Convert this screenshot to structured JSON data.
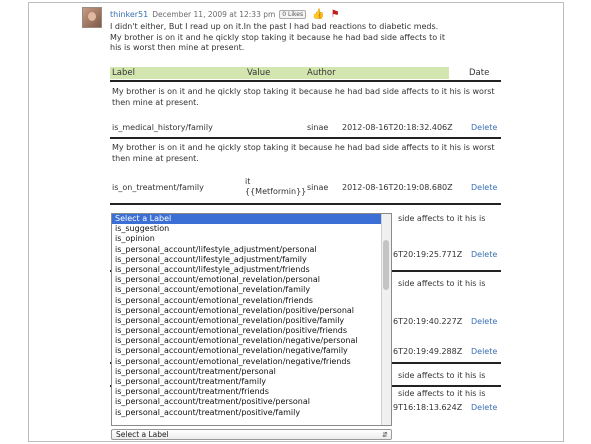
{
  "post": {
    "user": "thinker51",
    "date": "December 11, 2009 at 12:33 pm",
    "likes": "0 Likes",
    "comment": "I didn't either, But I read up on it.In the past I had bad reactions to diabetic meds. My brother is on it and he qickly stop taking it because he had bad side affects to it his is worst then mine at present."
  },
  "table": {
    "headers": {
      "label": "Label",
      "value": "Value",
      "author": "Author",
      "date": "Date"
    }
  },
  "rows": [
    {
      "text": "My brother is on it and he qickly stop taking it because he had bad side affects to it his is worst then mine at present.",
      "label": "is_medical_history/family",
      "value": "",
      "author": "sinae",
      "date": "2012-08-16T20:18:32.406Z",
      "action": "Delete"
    },
    {
      "text": "My brother is on it and he qickly stop taking it because he had bad side affects to it his is worst then mine at present.",
      "label": "is_on_treatment/family",
      "value": "it\n{{Metformin}}",
      "author": "sinae",
      "date": "2012-08-16T20:19:08.680Z",
      "action": "Delete"
    }
  ],
  "hidden_rows": [
    {
      "text_tail": "side affects to it his is",
      "date_tail": "6T20:19:25.771Z",
      "action": "Delete"
    },
    {
      "text_tail": "side affects to it his is",
      "date_tail": "6T20:19:40.227Z",
      "action": "Delete"
    },
    {
      "text_tail": "",
      "date_tail": "6T20:19:49.288Z",
      "action": "Delete"
    },
    {
      "text_tail": "side affects to it his is",
      "date_tail": "",
      "action": ""
    },
    {
      "text_tail": "side affects to it his is",
      "date_tail": "9T16:18:13.624Z",
      "action": "Delete"
    }
  ],
  "dropdown": {
    "options": [
      "Select a Label",
      "is_suggestion",
      "is_opinion",
      "is_personal_account/lifestyle_adjustment/personal",
      "is_personal_account/lifestyle_adjustment/family",
      "is_personal_account/lifestyle_adjustment/friends",
      "is_personal_account/emotional_revelation/personal",
      "is_personal_account/emotional_revelation/family",
      "is_personal_account/emotional_revelation/friends",
      "is_personal_account/emotional_revelation/positive/personal",
      "is_personal_account/emotional_revelation/positive/family",
      "is_personal_account/emotional_revelation/positive/friends",
      "is_personal_account/emotional_revelation/negative/personal",
      "is_personal_account/emotional_revelation/negative/family",
      "is_personal_account/emotional_revelation/negative/friends",
      "is_personal_account/treatment/personal",
      "is_personal_account/treatment/family",
      "is_personal_account/treatment/friends",
      "is_personal_account/treatment/positive/personal",
      "is_personal_account/treatment/positive/family"
    ],
    "selected_label": "Select a Label"
  },
  "icons": {
    "thumb": "thumbs-up-icon",
    "flag": "flag-icon"
  },
  "colors": {
    "link": "#3a6fb0",
    "header_bg": "#d4e6b0",
    "selection": "#3b6fd6"
  }
}
